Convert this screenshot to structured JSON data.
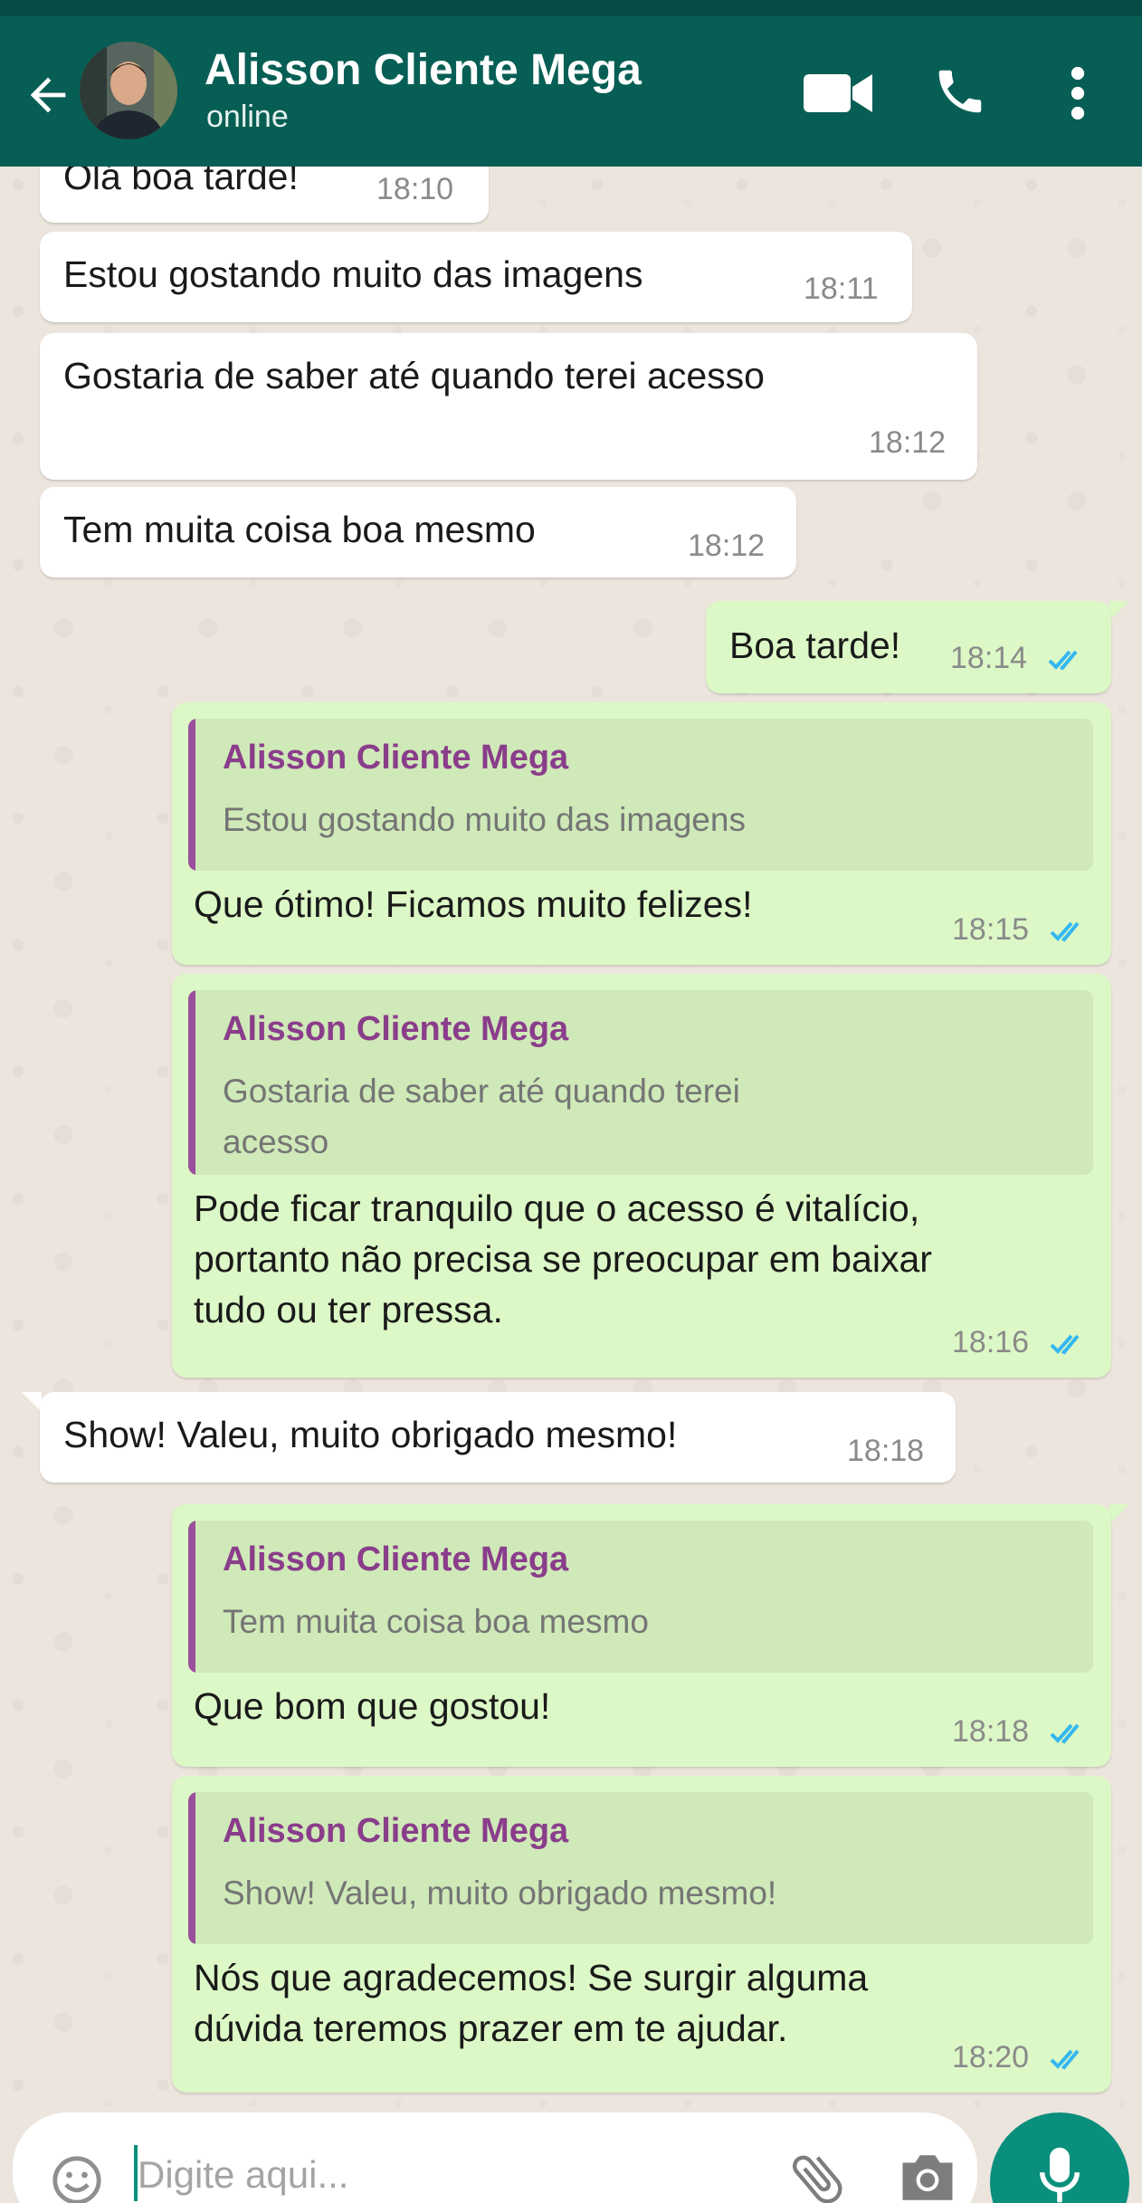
{
  "header": {
    "contact_name": "Alisson Cliente Mega",
    "status": "online",
    "colors": {
      "bar": "#075e54",
      "status_bar": "#054d44"
    },
    "icons": [
      "back-arrow-icon",
      "avatar",
      "video-call-icon",
      "phone-icon",
      "more-vert-icon"
    ]
  },
  "messages": [
    {
      "dir": "in",
      "text": "Olá boa tarde!",
      "time": "18:10"
    },
    {
      "dir": "in",
      "text": "Estou gostando muito das imagens",
      "time": "18:11"
    },
    {
      "dir": "in",
      "text": "Gostaria de saber até quando terei acesso",
      "time": "18:12"
    },
    {
      "dir": "in",
      "text": "Tem muita coisa boa mesmo",
      "time": "18:12"
    },
    {
      "dir": "out",
      "text": "Boa tarde!",
      "time": "18:14"
    },
    {
      "dir": "out",
      "quote": {
        "author": "Alisson Cliente Mega",
        "text": "Estou gostando muito das imagens"
      },
      "text": "Que ótimo! Ficamos muito felizes!",
      "time": "18:15"
    },
    {
      "dir": "out",
      "quote": {
        "author": "Alisson Cliente Mega",
        "line1": "Gostaria de saber até quando terei",
        "line2": "acesso"
      },
      "line1": "Pode ficar tranquilo que o acesso é vitalício,",
      "line2": "portanto não precisa se preocupar em baixar",
      "line3": "tudo ou ter pressa.",
      "time": "18:16"
    },
    {
      "dir": "in",
      "text": "Show! Valeu, muito obrigado mesmo!",
      "time": "18:18"
    },
    {
      "dir": "out",
      "quote": {
        "author": "Alisson Cliente Mega",
        "text": "Tem muita coisa boa mesmo"
      },
      "text": "Que bom que gostou!",
      "time": "18:18"
    },
    {
      "dir": "out",
      "quote": {
        "author": "Alisson Cliente Mega",
        "text": "Show! Valeu, muito obrigado mesmo!"
      },
      "line1": "Nós que agradecemos! Se surgir alguma",
      "line2": "dúvida teremos prazer em te ajudar.",
      "time": "18:20"
    }
  ],
  "composer": {
    "placeholder": "Digite aqui...",
    "icons": [
      "emoji-icon",
      "attach-icon",
      "camera-icon",
      "mic-icon"
    ],
    "accent": "#0a8f7d"
  },
  "colors": {
    "incoming_bubble": "#ffffff",
    "outgoing_bubble": "#dcf8c6",
    "quote_author": "#8a3d8b",
    "read_ticks": "#34b7f1"
  }
}
